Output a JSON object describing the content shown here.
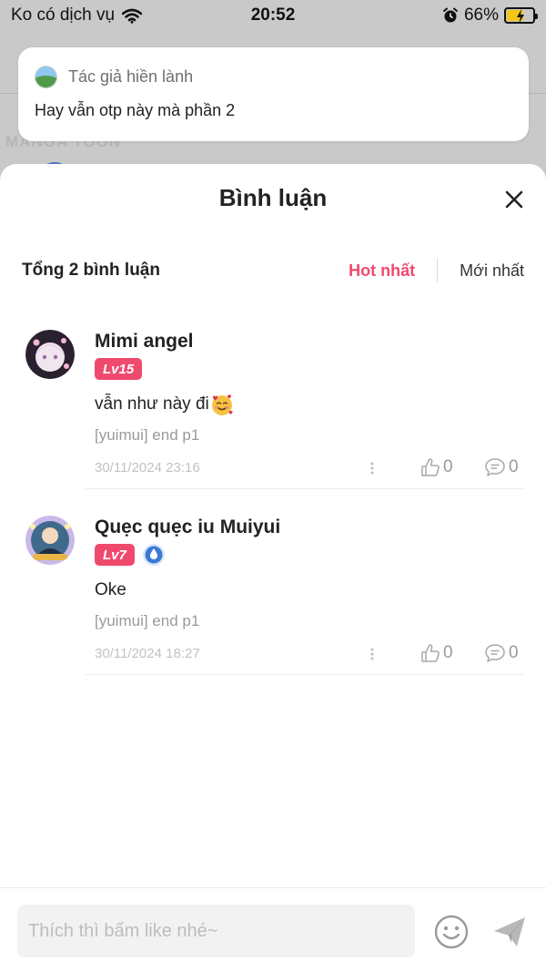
{
  "status_bar": {
    "carrier": "Ko có dịch vụ",
    "time": "20:52",
    "battery": "66%",
    "battery_level": 0.66
  },
  "notification": {
    "app_name": "Tác giả hiền lành",
    "message": "Hay vẫn otp này mà phần 2"
  },
  "background": {
    "logo_text": "MANGA TOON"
  },
  "sheet": {
    "title": "Bình luận",
    "total_label": "Tổng 2 bình luận",
    "sort_tabs": [
      {
        "label": "Hot nhất",
        "active": true
      },
      {
        "label": "Mới nhất",
        "active": false
      }
    ]
  },
  "comments": [
    {
      "name": "Mimi angel",
      "level": "Lv15",
      "text": "vẫn như này đi",
      "emoji": "smiling-face-with-hearts",
      "ref": "[yuimui] end p1",
      "date": "30/11/2024 23:16",
      "likes": "0",
      "replies": "0"
    },
    {
      "name": "Quẹc quẹc iu Muiyui",
      "level": "Lv7",
      "text": "Oke",
      "ref": "[yuimui] end p1",
      "date": "30/11/2024 18:27",
      "likes": "0",
      "replies": "0"
    }
  ],
  "input": {
    "placeholder": "Thích thì bấm like nhé~"
  },
  "colors": {
    "accent": "#ef4a6e",
    "battery": "#f5c518"
  }
}
